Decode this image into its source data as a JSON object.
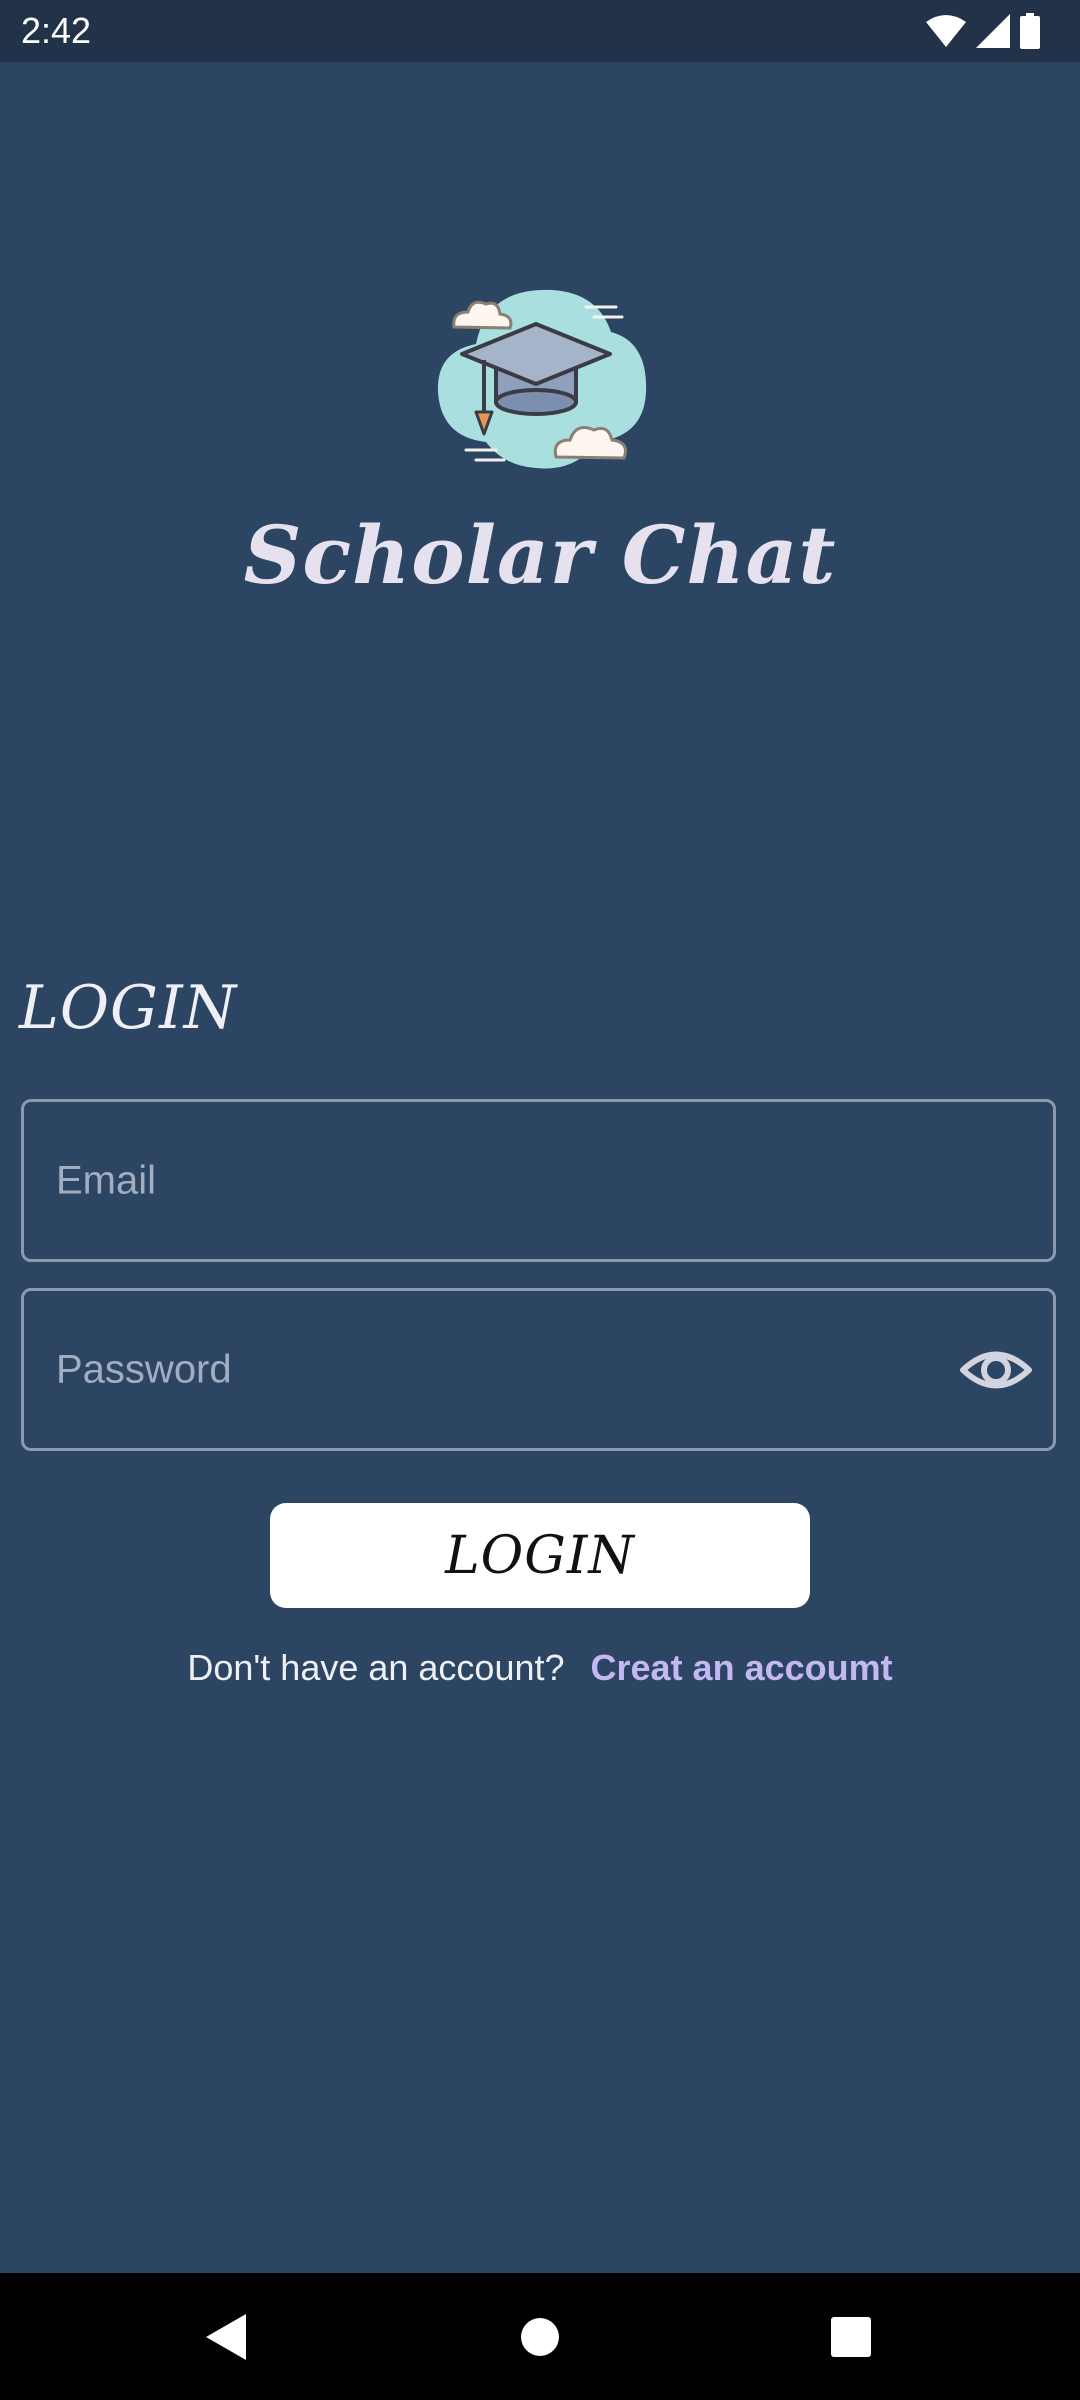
{
  "status_bar": {
    "time": "2:42",
    "icons": [
      "wifi-icon",
      "signal-icon",
      "battery-icon"
    ]
  },
  "app": {
    "title": "Scholar Chat",
    "logo_icon": "graduation-cap-cloud-icon"
  },
  "login_form": {
    "heading": "LOGIN",
    "email_placeholder": "Email",
    "password_placeholder": "Password",
    "visibility_icon": "eye-icon",
    "submit_label": "LOGIN",
    "signup_prompt": "Don't have an account?",
    "signup_link": "Creat an accoumt"
  },
  "nav_bar": {
    "buttons": [
      "back-icon",
      "home-icon",
      "recents-icon"
    ]
  },
  "colors": {
    "background": "#2c4563",
    "status_bar": "#213249",
    "field_border": "#8c9aae",
    "placeholder": "#a3adc0",
    "link": "#c4b8f2",
    "button_bg": "#ffffff"
  }
}
